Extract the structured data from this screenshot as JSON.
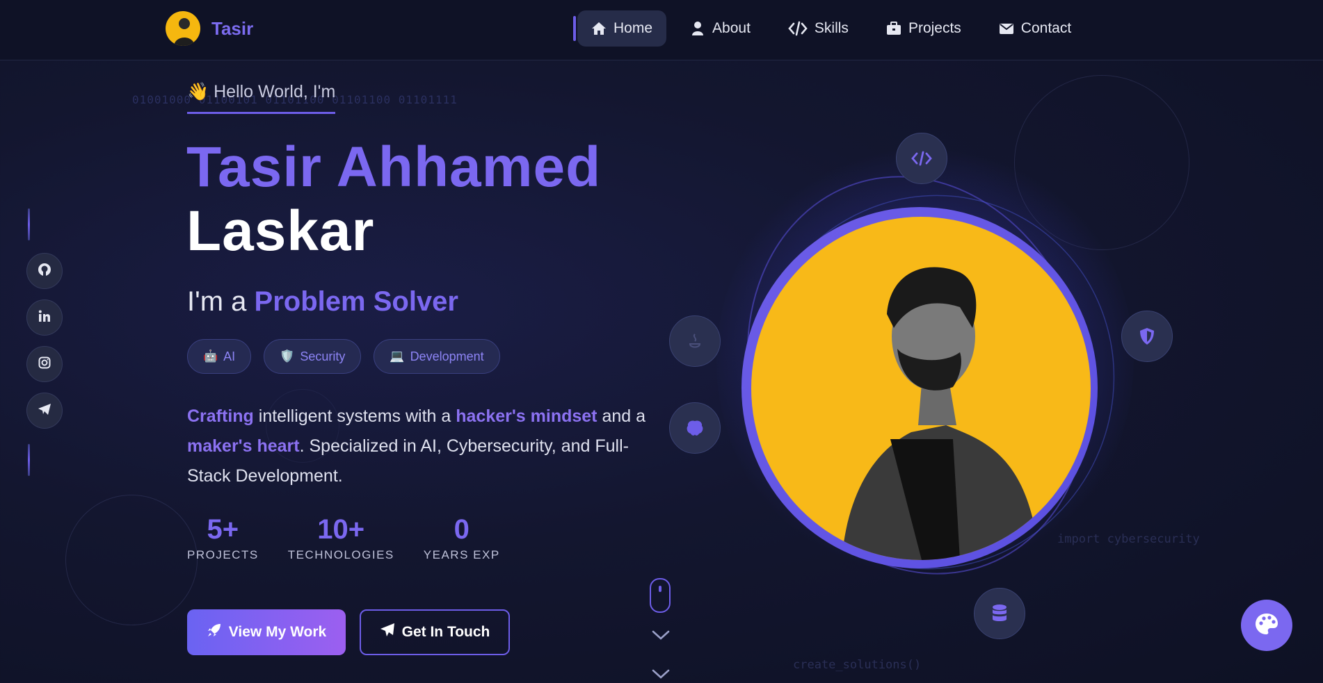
{
  "nav": {
    "brand": "Tasir",
    "items": [
      {
        "label": "Home",
        "icon": "home-icon",
        "active": true
      },
      {
        "label": "About",
        "icon": "user-icon",
        "active": false
      },
      {
        "label": "Skills",
        "icon": "code-icon",
        "active": false
      },
      {
        "label": "Projects",
        "icon": "briefcase-icon",
        "active": false
      },
      {
        "label": "Contact",
        "icon": "envelope-icon",
        "active": false
      }
    ]
  },
  "social": [
    "github-icon",
    "linkedin-icon",
    "instagram-icon",
    "telegram-icon"
  ],
  "hero": {
    "background_binary": "01001000 01100101 01101100 01101100 01101111",
    "greeting_emoji": "👋",
    "greeting": "Hello World, I'm",
    "name_line1": "Tasir Ahhamed",
    "name_line2": "Laskar",
    "role_prefix": "I'm a ",
    "role_highlight": "Problem Solver",
    "tags": [
      {
        "emoji": "🤖",
        "label": "AI"
      },
      {
        "emoji": "🛡️",
        "label": "Security"
      },
      {
        "emoji": "💻",
        "label": "Development"
      }
    ],
    "description": {
      "w1": "Crafting",
      "t1": " intelligent systems with a ",
      "w2": "hacker's mindset",
      "t2": " and a ",
      "w3": "maker's heart",
      "t3": ". Specialized in AI, Cybersecurity, and Full-Stack Development."
    },
    "stats": [
      {
        "value": "5+",
        "label": "PROJECTS"
      },
      {
        "value": "10+",
        "label": "TECHNOLOGIES"
      },
      {
        "value": "0",
        "label": "YEARS EXP"
      }
    ],
    "primary_button": "View My Work",
    "secondary_button": "Get In Touch"
  },
  "code_snippets": [
    "import cybersecurity",
    "create_solutions()"
  ],
  "orbit_icons": [
    "code-icon",
    "java-icon",
    "brain-icon",
    "shield-icon",
    "database-icon"
  ],
  "colors": {
    "accent": "#7b68f0",
    "portrait_bg": "#f8b918",
    "background": "#13162f"
  }
}
